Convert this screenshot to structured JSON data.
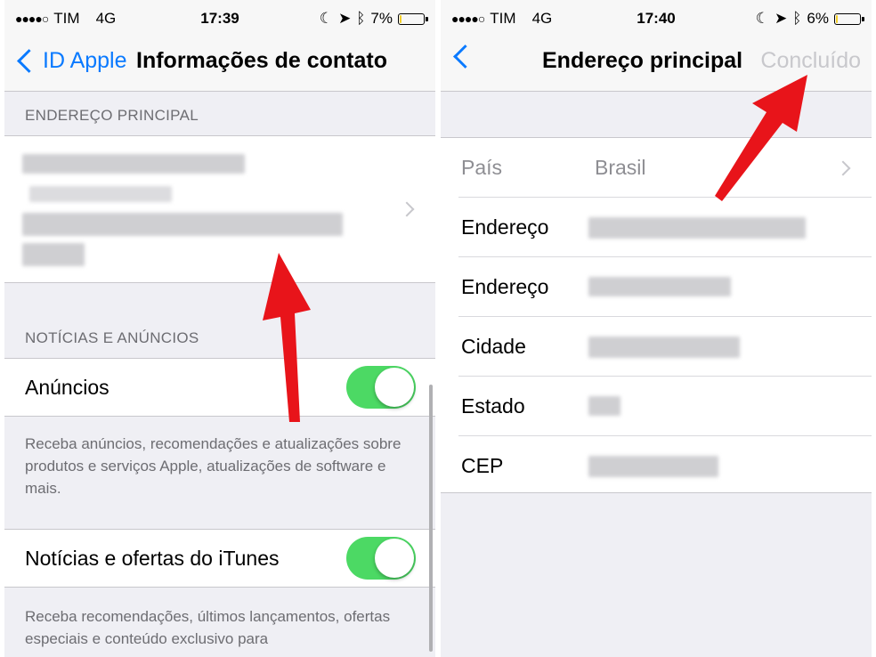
{
  "left": {
    "status": {
      "carrier": "TIM",
      "network": "4G",
      "time": "17:39",
      "battery": "7%",
      "battery_level": 0.07
    },
    "nav": {
      "back_label": "ID Apple",
      "title": "Informações de contato"
    },
    "address_section": {
      "header": "ENDEREÇO PRINCIPAL"
    },
    "news_section": {
      "header": "NOTÍCIAS E ANÚNCIOS"
    },
    "ads": {
      "label": "Anúncios",
      "enabled": true,
      "footer": "Receba anúncios, recomendações e atualizações sobre produtos e serviços Apple, atualizações de software e mais."
    },
    "itunes": {
      "label": "Notícias e ofertas do iTunes",
      "enabled": true,
      "footer": "Receba recomendações, últimos lançamentos, ofertas especiais e conteúdo exclusivo para"
    }
  },
  "right": {
    "status": {
      "carrier": "TIM",
      "network": "4G",
      "time": "17:40",
      "battery": "6%",
      "battery_level": 0.06
    },
    "nav": {
      "title": "Endereço principal",
      "done_label": "Concluído"
    },
    "rows": [
      {
        "label": "País",
        "value": "Brasil"
      },
      {
        "label": "Endereço",
        "value": ""
      },
      {
        "label": "Endereço",
        "value": ""
      },
      {
        "label": "Cidade",
        "value": ""
      },
      {
        "label": "Estado",
        "value": ""
      },
      {
        "label": "CEP",
        "value": ""
      }
    ]
  },
  "colors": {
    "accent": "#0a7aff",
    "toggle_on": "#4cd964",
    "arrow": "#e8141a",
    "group_bg": "#efeff4"
  },
  "icons": [
    "signal-dots-icon",
    "moon-icon",
    "location-arrow-icon",
    "bluetooth-icon",
    "battery-icon",
    "chevron-left-icon",
    "chevron-right-icon",
    "red-arrow-annotation"
  ]
}
